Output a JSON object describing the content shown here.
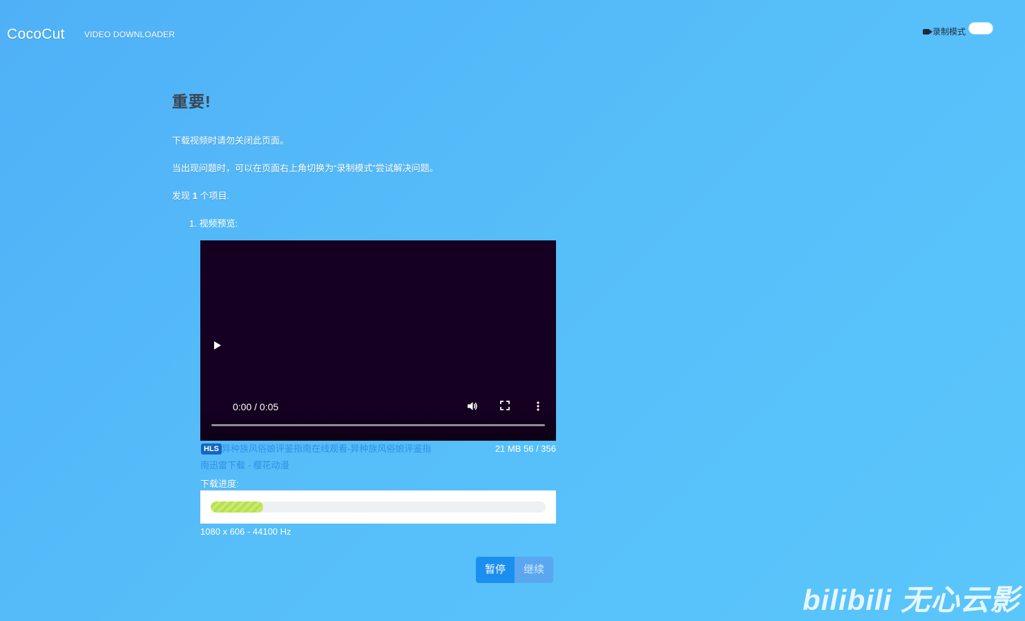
{
  "header": {
    "logo": "CocoCut",
    "subtitle": "VIDEO DOWNLOADER",
    "record_mode_label": "录制模式",
    "record_mode_enabled": false
  },
  "main": {
    "heading": "重要!",
    "notice_1": "下载视频时请勿关闭此页面。",
    "notice_2": "当出现问题时，可以在页面右上角切换为“录制模式”尝试解决问题。",
    "found_prefix": "发现",
    "found_count": "1",
    "found_suffix": "个项目.",
    "item_label": "1. 视频预览:"
  },
  "video": {
    "time": "0:00 / 0:05",
    "play_icon": "play-icon",
    "volume_icon": "volume-icon",
    "fullscreen_icon": "fullscreen-icon",
    "more_icon": "more-icon"
  },
  "item": {
    "badge": "HLS",
    "title": "异种族风俗娘评鉴指南在线观看-异种族风俗娘评鉴指南迅雷下载 - 樱花动漫",
    "size_info": "21 MB 56 / 356",
    "progress_label": "下载进度:",
    "progress_fraction": 0.157,
    "resolution": "1080 x 606 - 44100 Hz"
  },
  "actions": {
    "pause_label": "暂停",
    "resume_label": "继续"
  },
  "watermark": "bilibili 无心云影",
  "colors": {
    "background": "#56bdf9",
    "primary_button": "#1a8ff0",
    "progress_fill": "#c8eb6e",
    "video_bg": "#150021",
    "title_link": "#2f8fe8"
  }
}
